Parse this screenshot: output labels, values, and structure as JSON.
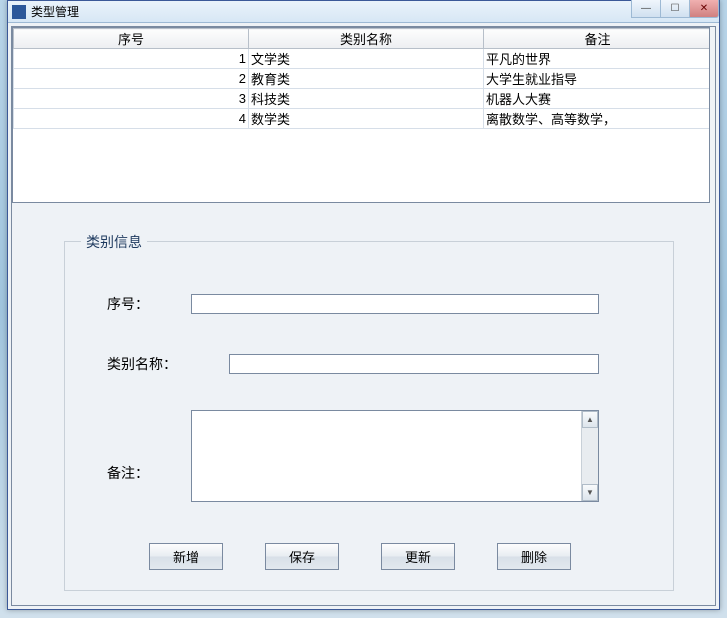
{
  "window": {
    "title": "类型管理"
  },
  "table": {
    "columns": [
      "序号",
      "类别名称",
      "备注"
    ],
    "rows": [
      {
        "id": "1",
        "name": "文学类",
        "note": "平凡的世界"
      },
      {
        "id": "2",
        "name": "教育类",
        "note": "大学生就业指导"
      },
      {
        "id": "3",
        "name": "科技类",
        "note": "机器人大赛"
      },
      {
        "id": "4",
        "name": "数学类",
        "note": "离散数学、高等数学，"
      }
    ]
  },
  "form": {
    "legend": "类别信息",
    "id_label": "序号：",
    "id_value": "",
    "name_label": "类别名称：",
    "name_value": "",
    "note_label": "备注：",
    "note_value": ""
  },
  "buttons": {
    "add": "新增",
    "save": "保存",
    "update": "更新",
    "delete": "删除"
  }
}
